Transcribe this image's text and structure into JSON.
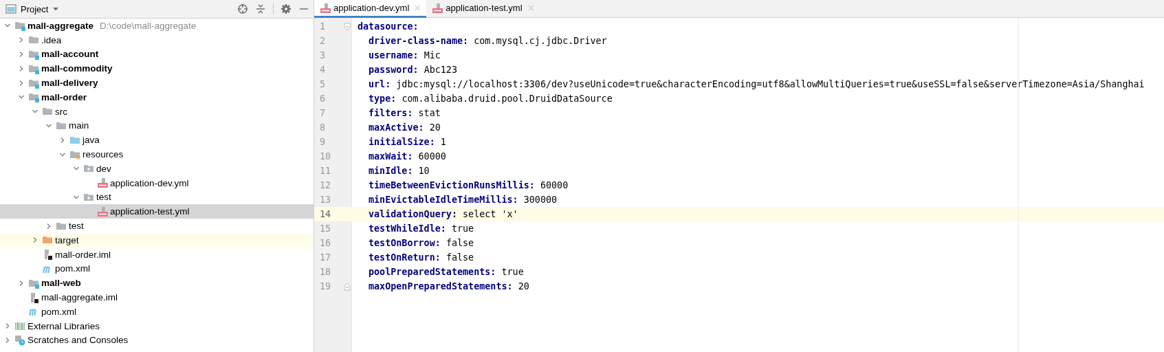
{
  "project_panel": {
    "title": "Project",
    "tree": [
      {
        "label": "mall-aggregate",
        "kind": "module",
        "location": "D:\\code\\mall-aggregate",
        "expanded": true,
        "selected": false,
        "children": [
          {
            "label": ".idea",
            "kind": "folder",
            "expanded": false,
            "selected": false
          },
          {
            "label": "mall-account",
            "kind": "module",
            "expanded": false,
            "selected": false
          },
          {
            "label": "mall-commodity",
            "kind": "module",
            "expanded": false,
            "selected": false
          },
          {
            "label": "mall-delivery",
            "kind": "module",
            "expanded": false,
            "selected": false
          },
          {
            "label": "mall-order",
            "kind": "module",
            "expanded": true,
            "selected": false,
            "children": [
              {
                "label": "src",
                "kind": "folder",
                "expanded": true,
                "selected": false,
                "children": [
                  {
                    "label": "main",
                    "kind": "folder",
                    "expanded": true,
                    "selected": false,
                    "children": [
                      {
                        "label": "java",
                        "kind": "source-folder",
                        "expanded": false,
                        "selected": false
                      },
                      {
                        "label": "resources",
                        "kind": "resources-folder",
                        "expanded": true,
                        "selected": false,
                        "children": [
                          {
                            "label": "dev",
                            "kind": "package-folder",
                            "expanded": true,
                            "selected": false,
                            "children": [
                              {
                                "label": "application-dev.yml",
                                "kind": "yml",
                                "selected": false
                              }
                            ]
                          },
                          {
                            "label": "test",
                            "kind": "package-folder",
                            "expanded": true,
                            "selected": false,
                            "children": [
                              {
                                "label": "application-test.yml",
                                "kind": "yml",
                                "selected": true
                              }
                            ]
                          }
                        ]
                      }
                    ]
                  },
                  {
                    "label": "test",
                    "kind": "folder",
                    "expanded": false,
                    "selected": false
                  }
                ]
              },
              {
                "label": "target",
                "kind": "excluded-folder",
                "expanded": false,
                "selected": false
              },
              {
                "label": "mall-order.iml",
                "kind": "iml",
                "selected": false
              },
              {
                "label": "pom.xml",
                "kind": "maven",
                "selected": false
              }
            ]
          },
          {
            "label": "mall-web",
            "kind": "module",
            "expanded": false,
            "selected": false
          },
          {
            "label": "mall-aggregate.iml",
            "kind": "iml",
            "selected": false
          },
          {
            "label": "pom.xml",
            "kind": "maven",
            "selected": false
          }
        ]
      },
      {
        "label": "External Libraries",
        "kind": "libraries",
        "expanded": false,
        "selected": false
      },
      {
        "label": "Scratches and Consoles",
        "kind": "scratches",
        "expanded": false,
        "selected": false
      }
    ]
  },
  "editor": {
    "tabs": [
      {
        "label": "application-dev.yml",
        "selected": true
      },
      {
        "label": "application-test.yml",
        "selected": false
      }
    ],
    "lines": [
      {
        "number": "1",
        "key": "datasource:",
        "current": false,
        "children": [
          {
            "number": "2",
            "key": "driver-class-name:",
            "value": "com.mysql.cj.jdbc.Driver",
            "current": false
          },
          {
            "number": "3",
            "key": "username:",
            "value": "Mic",
            "current": false
          },
          {
            "number": "4",
            "key": "password:",
            "value": "Abc123",
            "current": false
          },
          {
            "number": "5",
            "key": "url:",
            "value": "jdbc:mysql://localhost:3306/dev?useUnicode=true&characterEncoding=utf8&allowMultiQueries=true&useSSL=false&serverTimezone=Asia/Shanghai",
            "current": false
          },
          {
            "number": "6",
            "key": "type:",
            "value": "com.alibaba.druid.pool.DruidDataSource",
            "current": false
          },
          {
            "number": "7",
            "key": "filters:",
            "value": "stat",
            "current": false
          },
          {
            "number": "8",
            "key": "maxActive:",
            "value": "20",
            "current": false
          },
          {
            "number": "9",
            "key": "initialSize:",
            "value": "1",
            "current": false
          },
          {
            "number": "10",
            "key": "maxWait:",
            "value": "60000",
            "current": false
          },
          {
            "number": "11",
            "key": "minIdle:",
            "value": "10",
            "current": false
          },
          {
            "number": "12",
            "key": "timeBetweenEvictionRunsMillis:",
            "value": "60000",
            "current": false
          },
          {
            "number": "13",
            "key": "minEvictableIdleTimeMillis:",
            "value": "300000",
            "current": false
          },
          {
            "number": "14",
            "key": "validationQuery:",
            "value": "select 'x'",
            "current": true
          },
          {
            "number": "15",
            "key": "testWhileIdle:",
            "value": "true",
            "current": false
          },
          {
            "number": "16",
            "key": "testOnBorrow:",
            "value": "false",
            "current": false
          },
          {
            "number": "17",
            "key": "testOnReturn:",
            "value": "false",
            "current": false
          },
          {
            "number": "18",
            "key": "poolPreparedStatements:",
            "value": "true",
            "current": false
          },
          {
            "number": "19",
            "key": "maxOpenPreparedStatements:",
            "value": "20",
            "current": false
          }
        ]
      }
    ]
  }
}
